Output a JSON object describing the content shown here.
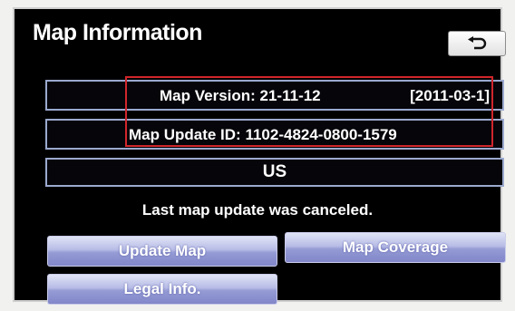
{
  "header": {
    "title": "Map Information",
    "back_icon": "return-arrow-icon"
  },
  "info": {
    "map_version_label": "Map Version:  21-11-12",
    "map_version_date": "[2011-03-1]",
    "map_update_id_label": "Map Update ID:  1102-4824-0800-1579",
    "region": "US"
  },
  "status": {
    "message": "Last map update was canceled."
  },
  "buttons": {
    "update_map": "Update Map",
    "map_coverage": "Map Coverage",
    "legal_info": "Legal Info."
  },
  "colors": {
    "screen_bg": "#000000",
    "button_blue": "#959bd4",
    "bar_border": "#9ba9ce",
    "highlight_red": "#d0262b"
  }
}
